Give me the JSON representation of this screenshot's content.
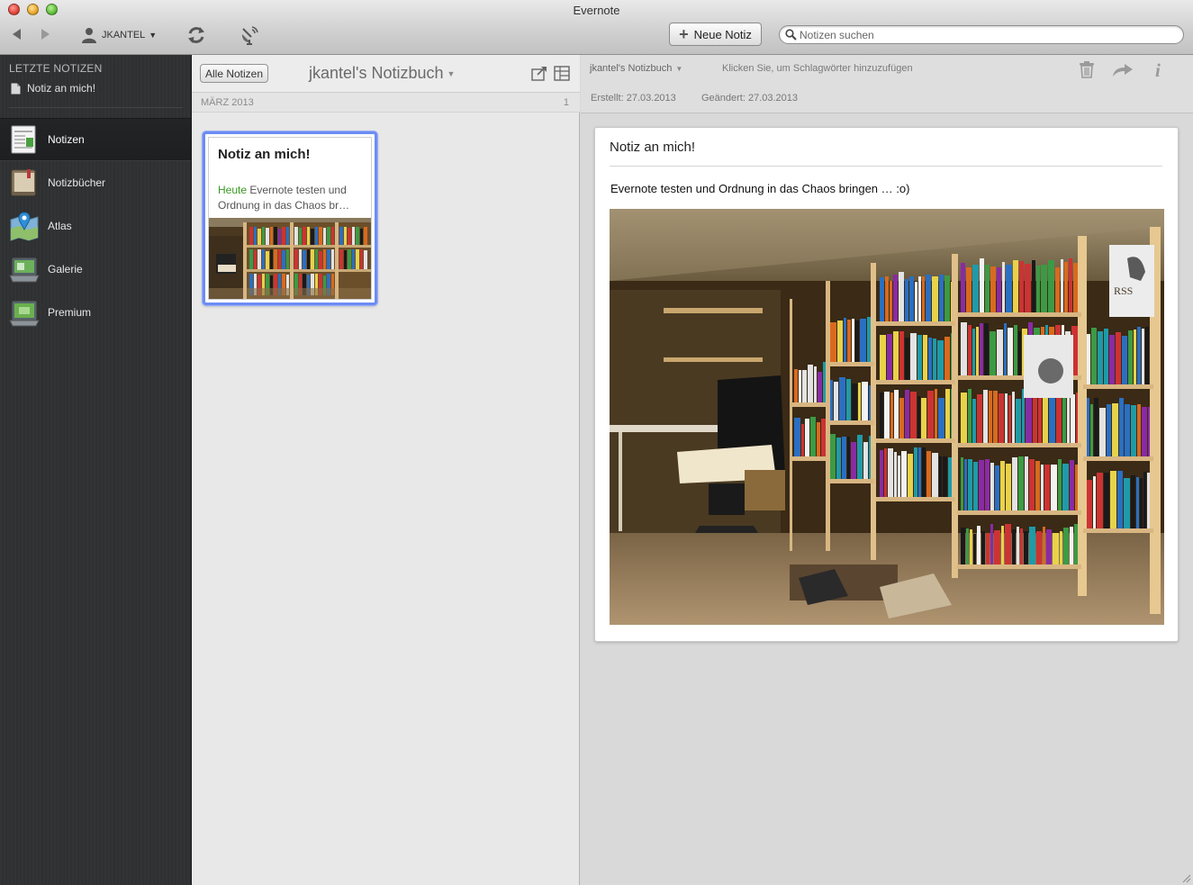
{
  "window": {
    "title": "Evernote"
  },
  "toolbar": {
    "account_label": "JKANTEL",
    "new_note_label": "Neue Notiz",
    "search_placeholder": "Notizen suchen"
  },
  "sidebar": {
    "recent_title": "LETZTE NOTIZEN",
    "recent_items": [
      {
        "label": "Notiz an mich!"
      }
    ],
    "items": [
      {
        "label": "Notizen",
        "icon": "notes-icon",
        "active": true
      },
      {
        "label": "Notizbücher",
        "icon": "notebooks-icon",
        "active": false
      },
      {
        "label": "Atlas",
        "icon": "atlas-icon",
        "active": false
      },
      {
        "label": "Galerie",
        "icon": "gallery-icon",
        "active": false
      },
      {
        "label": "Premium",
        "icon": "premium-icon",
        "active": false
      }
    ]
  },
  "note_list": {
    "all_notes_label": "Alle Notizen",
    "notebook_title": "jkantel's Notizbuch",
    "month_label": "MÄRZ 2013",
    "month_count": "1",
    "notes": [
      {
        "title": "Notiz an mich!",
        "date_label": "Heute",
        "snippet": "Evernote testen und Ordnung in das Chaos br…"
      }
    ]
  },
  "editor": {
    "notebook": "jkantel's Notizbuch",
    "tags_placeholder": "Klicken Sie, um Schlagwörter hinzuzufügen",
    "created": "Erstellt: 27.03.2013",
    "changed": "Geändert: 27.03.2013",
    "note_title": "Notiz an mich!",
    "note_body": "Evernote testen und Ordnung in das Chaos bringen … :o)"
  },
  "colors": {
    "sidebar_bg": "#2e3032",
    "selection_border": "#6c8cf4",
    "date_green": "#3a9a22"
  }
}
